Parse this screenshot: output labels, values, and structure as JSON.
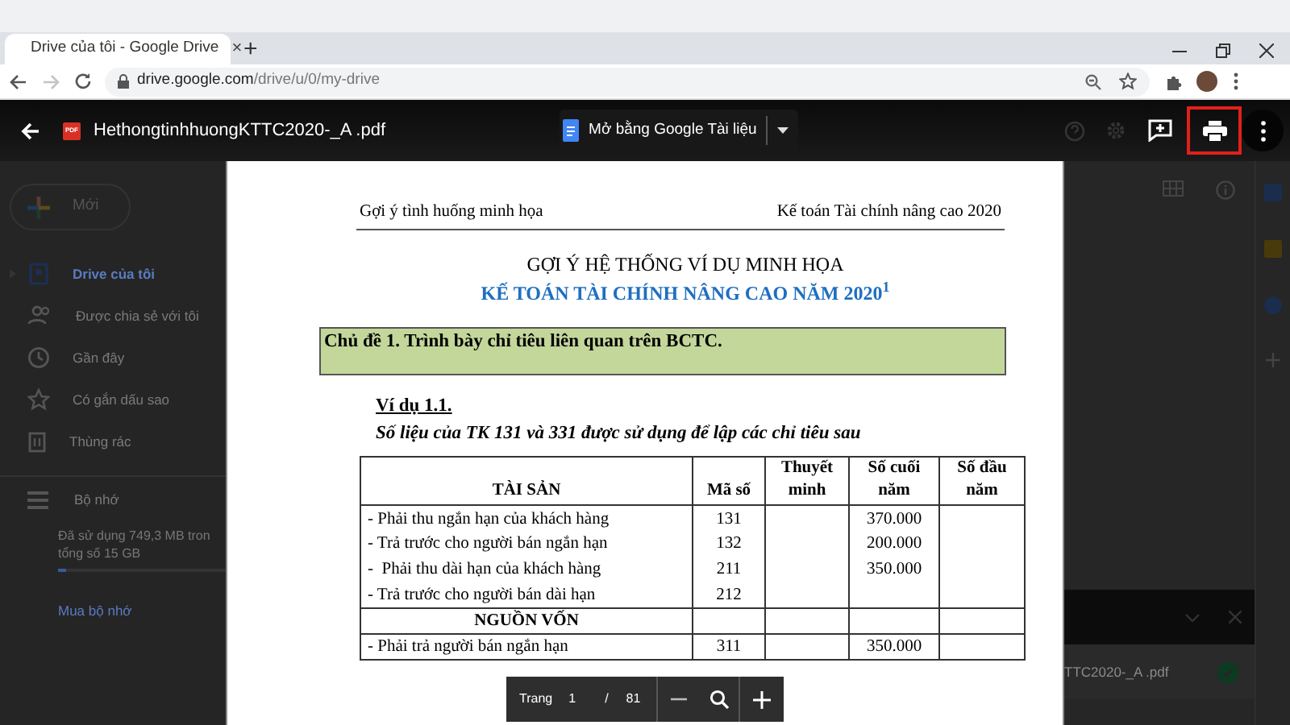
{
  "browser": {
    "tab": {
      "title": "Drive của tôi - Google Drive",
      "close": "×"
    },
    "new_tab": "+",
    "address": {
      "domain": "drive.google.com",
      "path": "/drive/u/0/my-drive"
    },
    "forward_disabled": true
  },
  "viewer": {
    "file_badge": "PDF",
    "file_name": "HethongtinhhuongKTTC2020-_A .pdf",
    "open_with": "Mở bằng Google Tài liệu",
    "actions": [
      {
        "kind": "comment",
        "highlighted": false
      },
      {
        "kind": "print",
        "highlighted": true
      },
      {
        "kind": "more",
        "highlighted": false
      }
    ]
  },
  "sidebar": {
    "new_button": "Mới",
    "items": [
      {
        "kind": "drive",
        "label": "Drive của tôi",
        "selected": true
      },
      {
        "kind": "shared",
        "label": "Được chia sẻ với tôi",
        "selected": false
      },
      {
        "kind": "recent",
        "label": "Gần đây",
        "selected": false
      },
      {
        "kind": "starred",
        "label": "Có gắn dấu sao",
        "selected": false
      },
      {
        "kind": "trash",
        "label": "Thùng rác",
        "selected": false
      }
    ],
    "storage": {
      "label": "Bộ nhớ",
      "usage_lines": [
        "Đã sử dụng 749,3 MB tron",
        "tổng số 15 GB"
      ],
      "level": 0.05,
      "buy_link": "Mua bộ nhớ"
    }
  },
  "document": {
    "running_header_left": "Gợi ý tình huống minh họa",
    "running_header_right": "Kế toán Tài chính nâng cao 2020",
    "title": "GỢI Ý HỆ THỐNG VÍ DỤ MINH HỌA",
    "subtitle": "KẾ TOÁN TÀI CHÍNH NÂNG CAO NĂM 2020$^{1}$",
    "topic": "Chủ đề 1. Trình bày chỉ tiêu liên quan trên BCTC.",
    "example_heading": "Ví dụ 1.1.",
    "example_intro": "Số liệu của TK 131 và 331 được sử dụng để lập các chỉ tiêu sau",
    "table": {
      "columns": [
        "TÀI SẢN",
        "Mã số",
        "Thuyết minh",
        "Số cuối năm",
        "Số đầu năm"
      ],
      "rows": [
        {
          "kind": "item",
          "item": "- Phải thu ngắn hạn của khách hàng",
          "code": "131",
          "year_end": "370.000"
        },
        {
          "kind": "item",
          "item": "- Trả trước cho người bán ngắn hạn",
          "code": "132",
          "year_end": "200.000"
        },
        {
          "kind": "item",
          "item": "-  Phải thu dài hạn của khách hàng",
          "code": "211",
          "year_end": "350.000"
        },
        {
          "kind": "item",
          "item": "- Trả trước cho người bán dài hạn",
          "code": "212"
        },
        {
          "kind": "section",
          "item": "NGUỒN VỐN"
        },
        {
          "kind": "item",
          "item": "- Phải trả người bán ngắn hạn",
          "code": "311",
          "year_end": "350.000"
        }
      ]
    }
  },
  "pager": {
    "label": "Trang",
    "page": "1",
    "separator": "/",
    "total": "81"
  },
  "download": {
    "file_name": "TTC2020-_A .pdf",
    "done": true
  }
}
